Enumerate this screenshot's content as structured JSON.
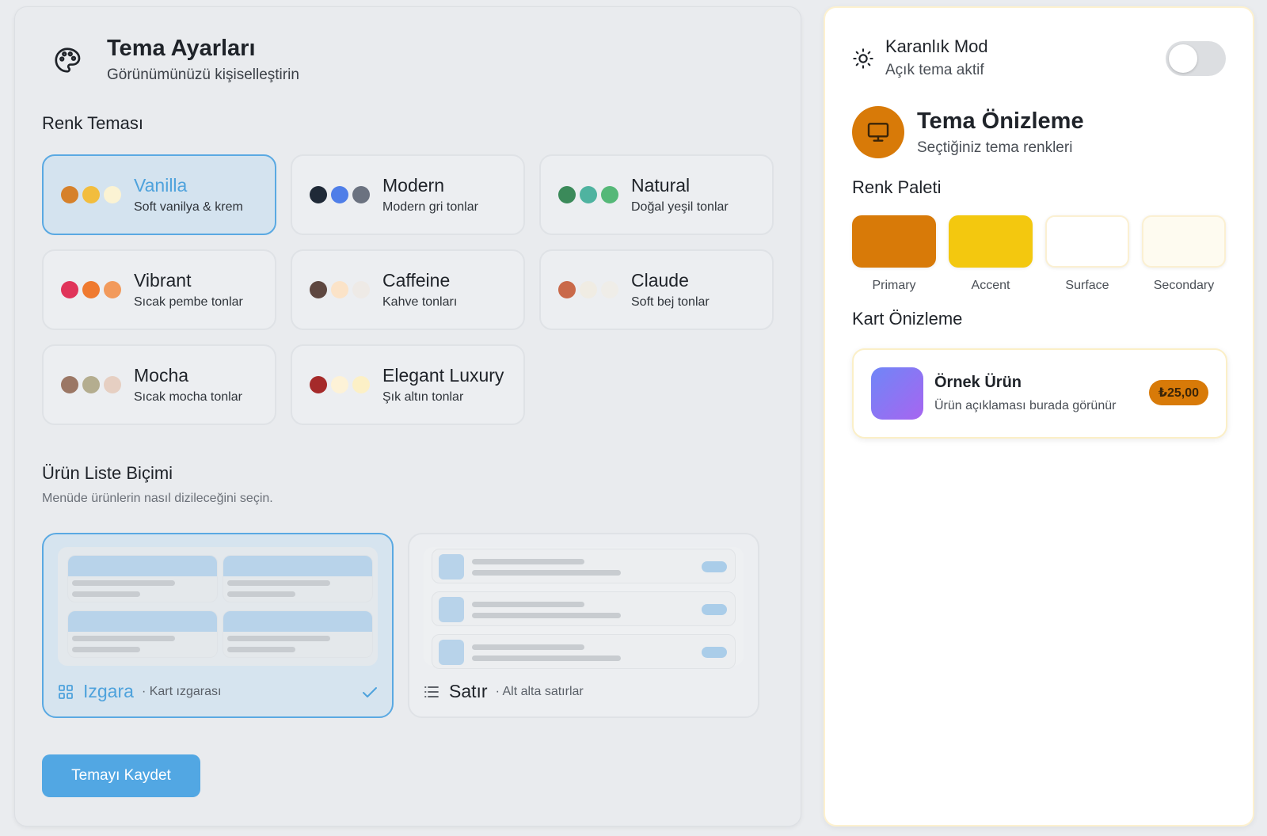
{
  "settings": {
    "title": "Tema Ayarları",
    "subtitle": "Görünümünüzü kişiselleştirin",
    "color_theme_heading": "Renk Teması",
    "themes": [
      {
        "name": "Vanilla",
        "desc": "Soft vanilya & krem",
        "colors": [
          "#d6812b",
          "#f2bd3e",
          "#fbf3d3"
        ],
        "selected": true
      },
      {
        "name": "Modern",
        "desc": "Modern gri tonlar",
        "colors": [
          "#1f2937",
          "#4f7ee8",
          "#6b7280"
        ],
        "selected": false
      },
      {
        "name": "Natural",
        "desc": "Doğal yeşil tonlar",
        "colors": [
          "#3b8a5a",
          "#4fb3a0",
          "#55b878"
        ],
        "selected": false
      },
      {
        "name": "Vibrant",
        "desc": "Sıcak pembe tonlar",
        "colors": [
          "#e0345a",
          "#ef7a30",
          "#f29a5c"
        ],
        "selected": false
      },
      {
        "name": "Caffeine",
        "desc": "Kahve tonları",
        "colors": [
          "#5e4740",
          "#fbe3c8",
          "#eeeae6"
        ],
        "selected": false
      },
      {
        "name": "Claude",
        "desc": "Soft bej tonlar",
        "colors": [
          "#c9694a",
          "#f0ece3",
          "#efede8"
        ],
        "selected": false
      },
      {
        "name": "Mocha",
        "desc": "Sıcak mocha tonlar",
        "colors": [
          "#9b7765",
          "#b4ad8f",
          "#e6cfc2"
        ],
        "selected": false
      },
      {
        "name": "Elegant Luxury",
        "desc": "Şık altın tonlar",
        "colors": [
          "#a52a2a",
          "#fdf2d7",
          "#fcf0c6"
        ],
        "selected": false
      }
    ],
    "list_format_heading": "Ürün Liste Biçimi",
    "list_format_sub": "Menüde ürünlerin nasıl dizileceğini seçin.",
    "layouts": {
      "grid": {
        "name": "Izgara",
        "desc": "· Kart ızgarası",
        "selected": true,
        "icon": "grid-icon"
      },
      "row": {
        "name": "Satır",
        "desc": "· Alt alta satırlar",
        "selected": false,
        "icon": "list-icon"
      }
    },
    "save_label": "Temayı Kaydet"
  },
  "preview": {
    "dark_mode_title": "Karanlık Mod",
    "dark_mode_status": "Açık tema aktif",
    "dark_mode_on": false,
    "title": "Tema Önizleme",
    "subtitle": "Seçtiğiniz tema renkleri",
    "palette_heading": "Renk Paleti",
    "palette": [
      {
        "label": "Primary",
        "color": "#d87a08"
      },
      {
        "label": "Accent",
        "color": "#f3c80f"
      },
      {
        "label": "Surface",
        "color": "#ffffff"
      },
      {
        "label": "Secondary",
        "color": "#fefbf0"
      }
    ],
    "card_heading": "Kart Önizleme",
    "card": {
      "name": "Örnek Ürün",
      "desc": "Ürün açıklaması burada görünür",
      "price": "₺25,00"
    }
  }
}
